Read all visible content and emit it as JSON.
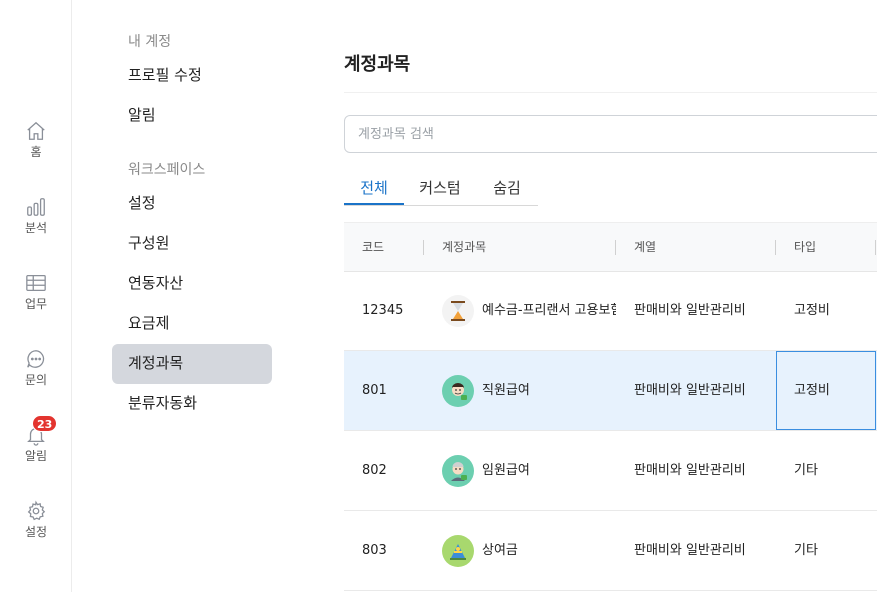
{
  "rail": {
    "items": [
      {
        "label": "홈",
        "icon": "home-icon"
      },
      {
        "label": "분석",
        "icon": "bar-chart-icon"
      },
      {
        "label": "업무",
        "icon": "table-icon"
      },
      {
        "label": "문의",
        "icon": "chat-icon"
      },
      {
        "label": "알림",
        "icon": "bell-icon",
        "badge": "23"
      },
      {
        "label": "설정",
        "icon": "gear-icon"
      }
    ],
    "badge_color": "#e3342f"
  },
  "sidebar": {
    "account_heading": "내 계정",
    "account_items": [
      "프로필 수정",
      "알림"
    ],
    "workspace_heading": "워크스페이스",
    "workspace_items": [
      "설정",
      "구성원",
      "연동자산",
      "요금제",
      "계정과목",
      "분류자동화"
    ],
    "active_item": "계정과목"
  },
  "main": {
    "title": "계정과목",
    "search_placeholder": "계정과목 검색",
    "tabs": [
      "전체",
      "커스텀",
      "숨김"
    ],
    "active_tab": "전체",
    "accent_color": "#1a73c8",
    "columns": [
      "코드",
      "계정과목",
      "계열",
      "타입"
    ],
    "rows": [
      {
        "code": "12345",
        "name": "예수금-프리랜서 고용보험",
        "category": "판매비와 일반관리비",
        "type": "고정비",
        "icon": "hourglass-icon"
      },
      {
        "code": "801",
        "name": "직원급여",
        "category": "판매비와 일반관리비",
        "type": "고정비",
        "icon": "employee-avatar-icon"
      },
      {
        "code": "802",
        "name": "임원급여",
        "category": "판매비와 일반관리비",
        "type": "기타",
        "icon": "executive-avatar-icon"
      },
      {
        "code": "803",
        "name": "상여금",
        "category": "판매비와 일반관리비",
        "type": "기타",
        "icon": "bonus-icon"
      }
    ]
  }
}
